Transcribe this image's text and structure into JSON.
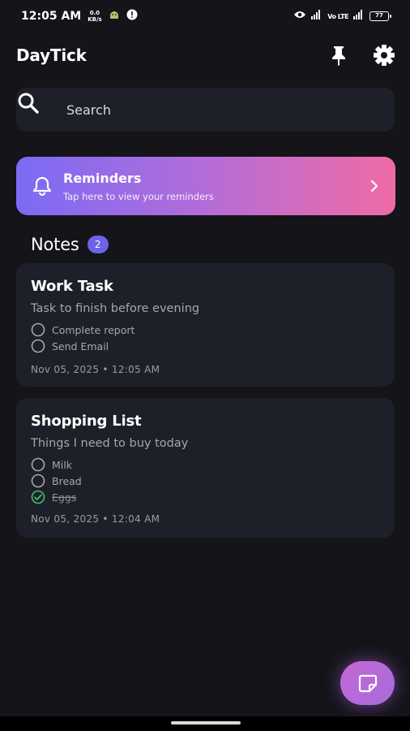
{
  "status_bar": {
    "time": "12:05 AM",
    "speed_value": "0.0",
    "speed_unit": "KB/s",
    "signal_text": "Vo LTE",
    "battery": "77"
  },
  "header": {
    "title": "DayTick"
  },
  "search": {
    "placeholder": "Search"
  },
  "reminders": {
    "title": "Reminders",
    "subtitle": "Tap here to view your reminders"
  },
  "notes": {
    "heading": "Notes",
    "count": "2",
    "items": [
      {
        "title": "Work Task",
        "description": "Task to finish before evening",
        "checklist": [
          {
            "label": "Complete report",
            "done": false
          },
          {
            "label": "Send Email",
            "done": false
          }
        ],
        "date": "Nov 05, 2025 • 12:05 AM"
      },
      {
        "title": "Shopping List",
        "description": "Things I need to buy today",
        "checklist": [
          {
            "label": "Milk",
            "done": false
          },
          {
            "label": "Bread",
            "done": false
          },
          {
            "label": "Eggs",
            "done": true
          }
        ],
        "date": "Nov 05, 2025 • 12:04 AM"
      }
    ]
  },
  "colors": {
    "background": "#141419",
    "card": "#1e2029",
    "accent": "#6d63e6",
    "gradient_start": "#7b6bf5",
    "gradient_end": "#f06ba4",
    "done_check": "#3fbf6a"
  },
  "icons": {
    "pin": "pin-icon",
    "settings": "gear-icon",
    "search": "search-icon",
    "bell": "bell-icon",
    "chevron": "chevron-right-icon",
    "new_note": "new-note-icon"
  }
}
